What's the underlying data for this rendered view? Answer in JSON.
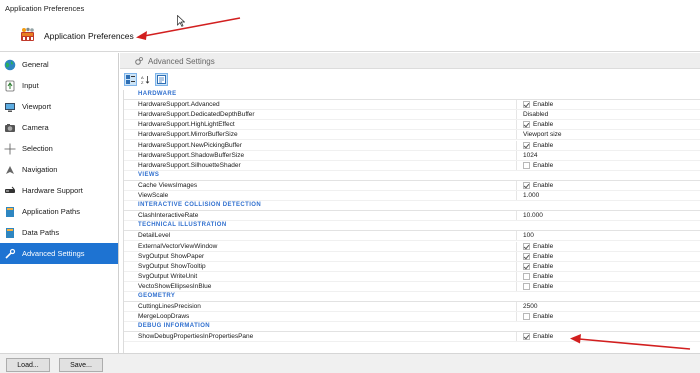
{
  "window": {
    "title": "Application Preferences"
  },
  "header": {
    "title": "Application Preferences",
    "icon": "app-preferences-icon"
  },
  "sidebar": {
    "items": [
      {
        "label": "General",
        "icon": "globe-icon",
        "active": false
      },
      {
        "label": "Input",
        "icon": "input-icon",
        "active": false
      },
      {
        "label": "Viewport",
        "icon": "viewport-icon",
        "active": false
      },
      {
        "label": "Camera",
        "icon": "camera-icon",
        "active": false
      },
      {
        "label": "Selection",
        "icon": "crosshair-icon",
        "active": false
      },
      {
        "label": "Navigation",
        "icon": "navigation-icon",
        "active": false
      },
      {
        "label": "Hardware Support",
        "icon": "hardware-icon",
        "active": false
      },
      {
        "label": "Application Paths",
        "icon": "book-icon",
        "active": false
      },
      {
        "label": "Data Paths",
        "icon": "book-icon",
        "active": false
      },
      {
        "label": "Advanced Settings",
        "icon": "wrench-icon",
        "active": true
      }
    ]
  },
  "panel": {
    "title": "Advanced Settings"
  },
  "grid": {
    "rows": [
      {
        "type": "category",
        "label": "HARDWARE"
      },
      {
        "type": "prop",
        "name": "HardwareSupport.Advanced",
        "value": "Enable",
        "checkbox": true,
        "checked": true
      },
      {
        "type": "prop",
        "name": "HardwareSupport.DedicatedDepthBuffer",
        "value": "Disabled",
        "checkbox": false
      },
      {
        "type": "prop",
        "name": "HardwareSupport.HighLightEffect",
        "value": "Enable",
        "checkbox": true,
        "checked": true
      },
      {
        "type": "prop",
        "name": "HardwareSupport.MirrorBufferSize",
        "value": "Viewport size",
        "checkbox": false
      },
      {
        "type": "prop",
        "name": "HardwareSupport.NewPickingBuffer",
        "value": "Enable",
        "checkbox": true,
        "checked": true
      },
      {
        "type": "prop",
        "name": "HardwareSupport.ShadowBufferSize",
        "value": "1024",
        "checkbox": false
      },
      {
        "type": "prop",
        "name": "HardwareSupport.SilhouetteShader",
        "value": "Enable",
        "checkbox": true,
        "checked": false
      },
      {
        "type": "category",
        "label": "VIEWS"
      },
      {
        "type": "prop",
        "name": "Cache ViewsImages",
        "value": "Enable",
        "checkbox": true,
        "checked": true
      },
      {
        "type": "prop",
        "name": "ViewScale",
        "value": "1.000",
        "checkbox": false
      },
      {
        "type": "category",
        "label": "INTERACTIVE COLLISION DETECTION"
      },
      {
        "type": "prop",
        "name": "ClashInteractiveRate",
        "value": "10.000",
        "checkbox": false
      },
      {
        "type": "category",
        "label": "TECHNICAL ILLUSTRATION"
      },
      {
        "type": "prop",
        "name": "DetailLevel",
        "value": "100",
        "checkbox": false
      },
      {
        "type": "prop",
        "name": "ExternalVectorViewWindow",
        "value": "Enable",
        "checkbox": true,
        "checked": true
      },
      {
        "type": "prop",
        "name": "SvgOutput ShowPaper",
        "value": "Enable",
        "checkbox": true,
        "checked": true
      },
      {
        "type": "prop",
        "name": "SvgOutput ShowTooltip",
        "value": "Enable",
        "checkbox": true,
        "checked": true
      },
      {
        "type": "prop",
        "name": "SvgOutput WriteUnit",
        "value": "Enable",
        "checkbox": true,
        "checked": false
      },
      {
        "type": "prop",
        "name": "VectoShowEllipsesInBlue",
        "value": "Enable",
        "checkbox": true,
        "checked": false
      },
      {
        "type": "category",
        "label": "GEOMETRY"
      },
      {
        "type": "prop",
        "name": "CuttingLinesPrecision",
        "value": "2500",
        "checkbox": false
      },
      {
        "type": "prop",
        "name": "MergeLoopDraws",
        "value": "Enable",
        "checkbox": true,
        "checked": false
      },
      {
        "type": "category",
        "label": "DEBUG INFORMATION"
      },
      {
        "type": "prop",
        "name": "ShowDebugPropertiesInPropertiesPane",
        "value": "Enable",
        "checkbox": true,
        "checked": true
      }
    ]
  },
  "footer": {
    "load_label": "Load...",
    "save_label": "Save..."
  },
  "colors": {
    "accent": "#1e73d2",
    "category": "#2f6fce",
    "annotation_arrow": "#d21f1f"
  }
}
